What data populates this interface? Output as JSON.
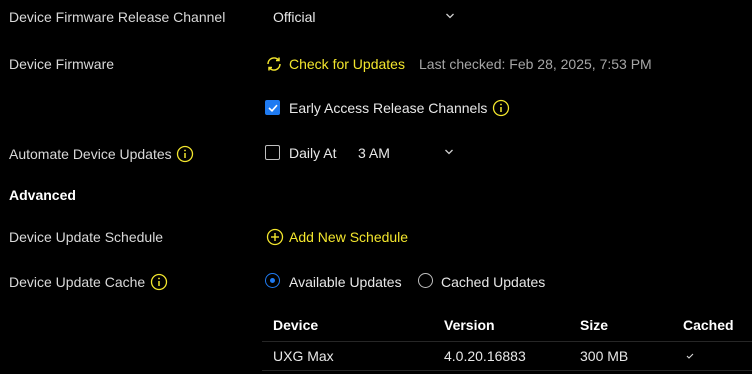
{
  "firmware_channel": {
    "label": "Device Firmware Release Channel",
    "value": "Official"
  },
  "device_firmware": {
    "label": "Device Firmware",
    "check_label": "Check for Updates",
    "last_checked": "Last checked: Feb 28, 2025, 7:53 PM",
    "early_access_label": "Early Access Release Channels",
    "early_access_checked": true
  },
  "automate": {
    "label": "Automate Device Updates",
    "daily_label": "Daily At",
    "daily_checked": false,
    "time_value": "3 AM"
  },
  "advanced": {
    "heading": "Advanced"
  },
  "schedule": {
    "label": "Device Update Schedule",
    "add_label": "Add New Schedule"
  },
  "cache": {
    "label": "Device Update Cache",
    "options": [
      {
        "label": "Available Updates",
        "selected": true
      },
      {
        "label": "Cached Updates",
        "selected": false
      }
    ]
  },
  "table": {
    "headers": [
      "Device",
      "Version",
      "Size",
      "Cached"
    ],
    "rows": [
      {
        "device": "UXG Max",
        "version": "4.0.20.16883",
        "size": "300 MB",
        "cached": true
      }
    ]
  },
  "colors": {
    "accent": "#f3e62d",
    "selection": "#1f7bf2",
    "background": "#000000"
  }
}
